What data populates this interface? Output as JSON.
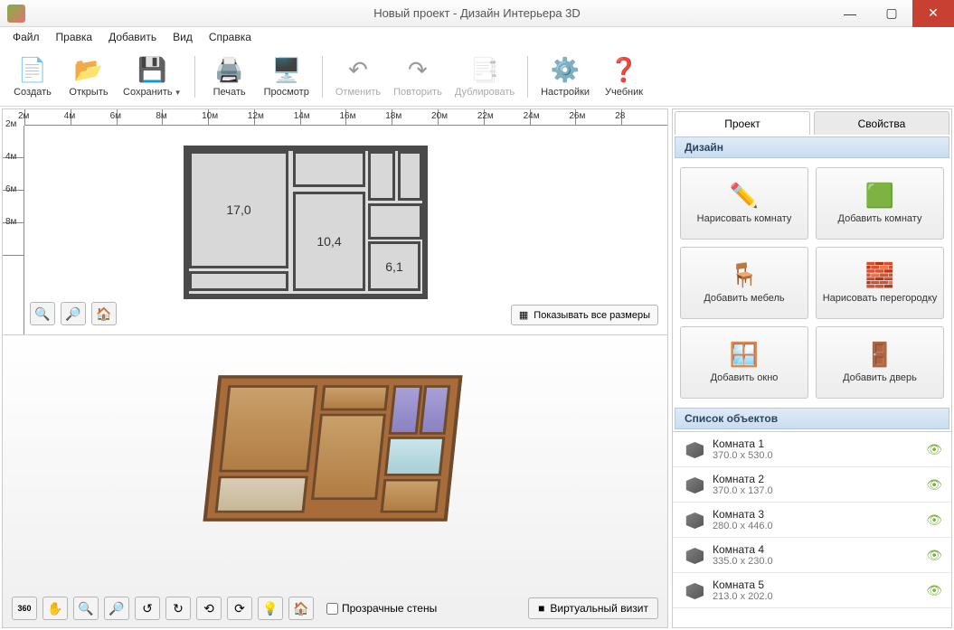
{
  "window": {
    "title": "Новый проект - Дизайн Интерьера 3D"
  },
  "menu": {
    "items": [
      "Файл",
      "Правка",
      "Добавить",
      "Вид",
      "Справка"
    ]
  },
  "toolbar": {
    "create": "Создать",
    "open": "Открыть",
    "save": "Сохранить",
    "print": "Печать",
    "preview": "Просмотр",
    "undo": "Отменить",
    "redo": "Повторить",
    "duplicate": "Дублировать",
    "settings": "Настройки",
    "tutorial": "Учебник"
  },
  "ruler_h": [
    "2м",
    "4м",
    "6м",
    "8м",
    "10м",
    "12м",
    "14м",
    "16м",
    "18м",
    "20м",
    "22м",
    "24м",
    "26м",
    "28"
  ],
  "ruler_v": [
    "2м",
    "4м",
    "6м",
    "8м"
  ],
  "rooms2d": {
    "r1": "17,0",
    "r2": "10,4",
    "r3": "6,1"
  },
  "plan": {
    "show_sizes": "Показывать все размеры"
  },
  "threed": {
    "transparent_walls": "Прозрачные стены",
    "virtual_visit": "Виртуальный визит"
  },
  "side": {
    "tab_project": "Проект",
    "tab_props": "Свойства",
    "design_hdr": "Дизайн",
    "btn_draw_room": "Нарисовать\nкомнату",
    "btn_add_room": "Добавить\nкомнату",
    "btn_add_furn": "Добавить\nмебель",
    "btn_draw_wall": "Нарисовать\nперегородку",
    "btn_add_win": "Добавить\nокно",
    "btn_add_door": "Добавить\nдверь",
    "objects_hdr": "Список объектов",
    "objects": [
      {
        "name": "Комната 1",
        "size": "370.0 x 530.0"
      },
      {
        "name": "Комната 2",
        "size": "370.0 x 137.0"
      },
      {
        "name": "Комната 3",
        "size": "280.0 x 446.0"
      },
      {
        "name": "Комната 4",
        "size": "335.0 x 230.0"
      },
      {
        "name": "Комната 5",
        "size": "213.0 x 202.0"
      }
    ]
  }
}
